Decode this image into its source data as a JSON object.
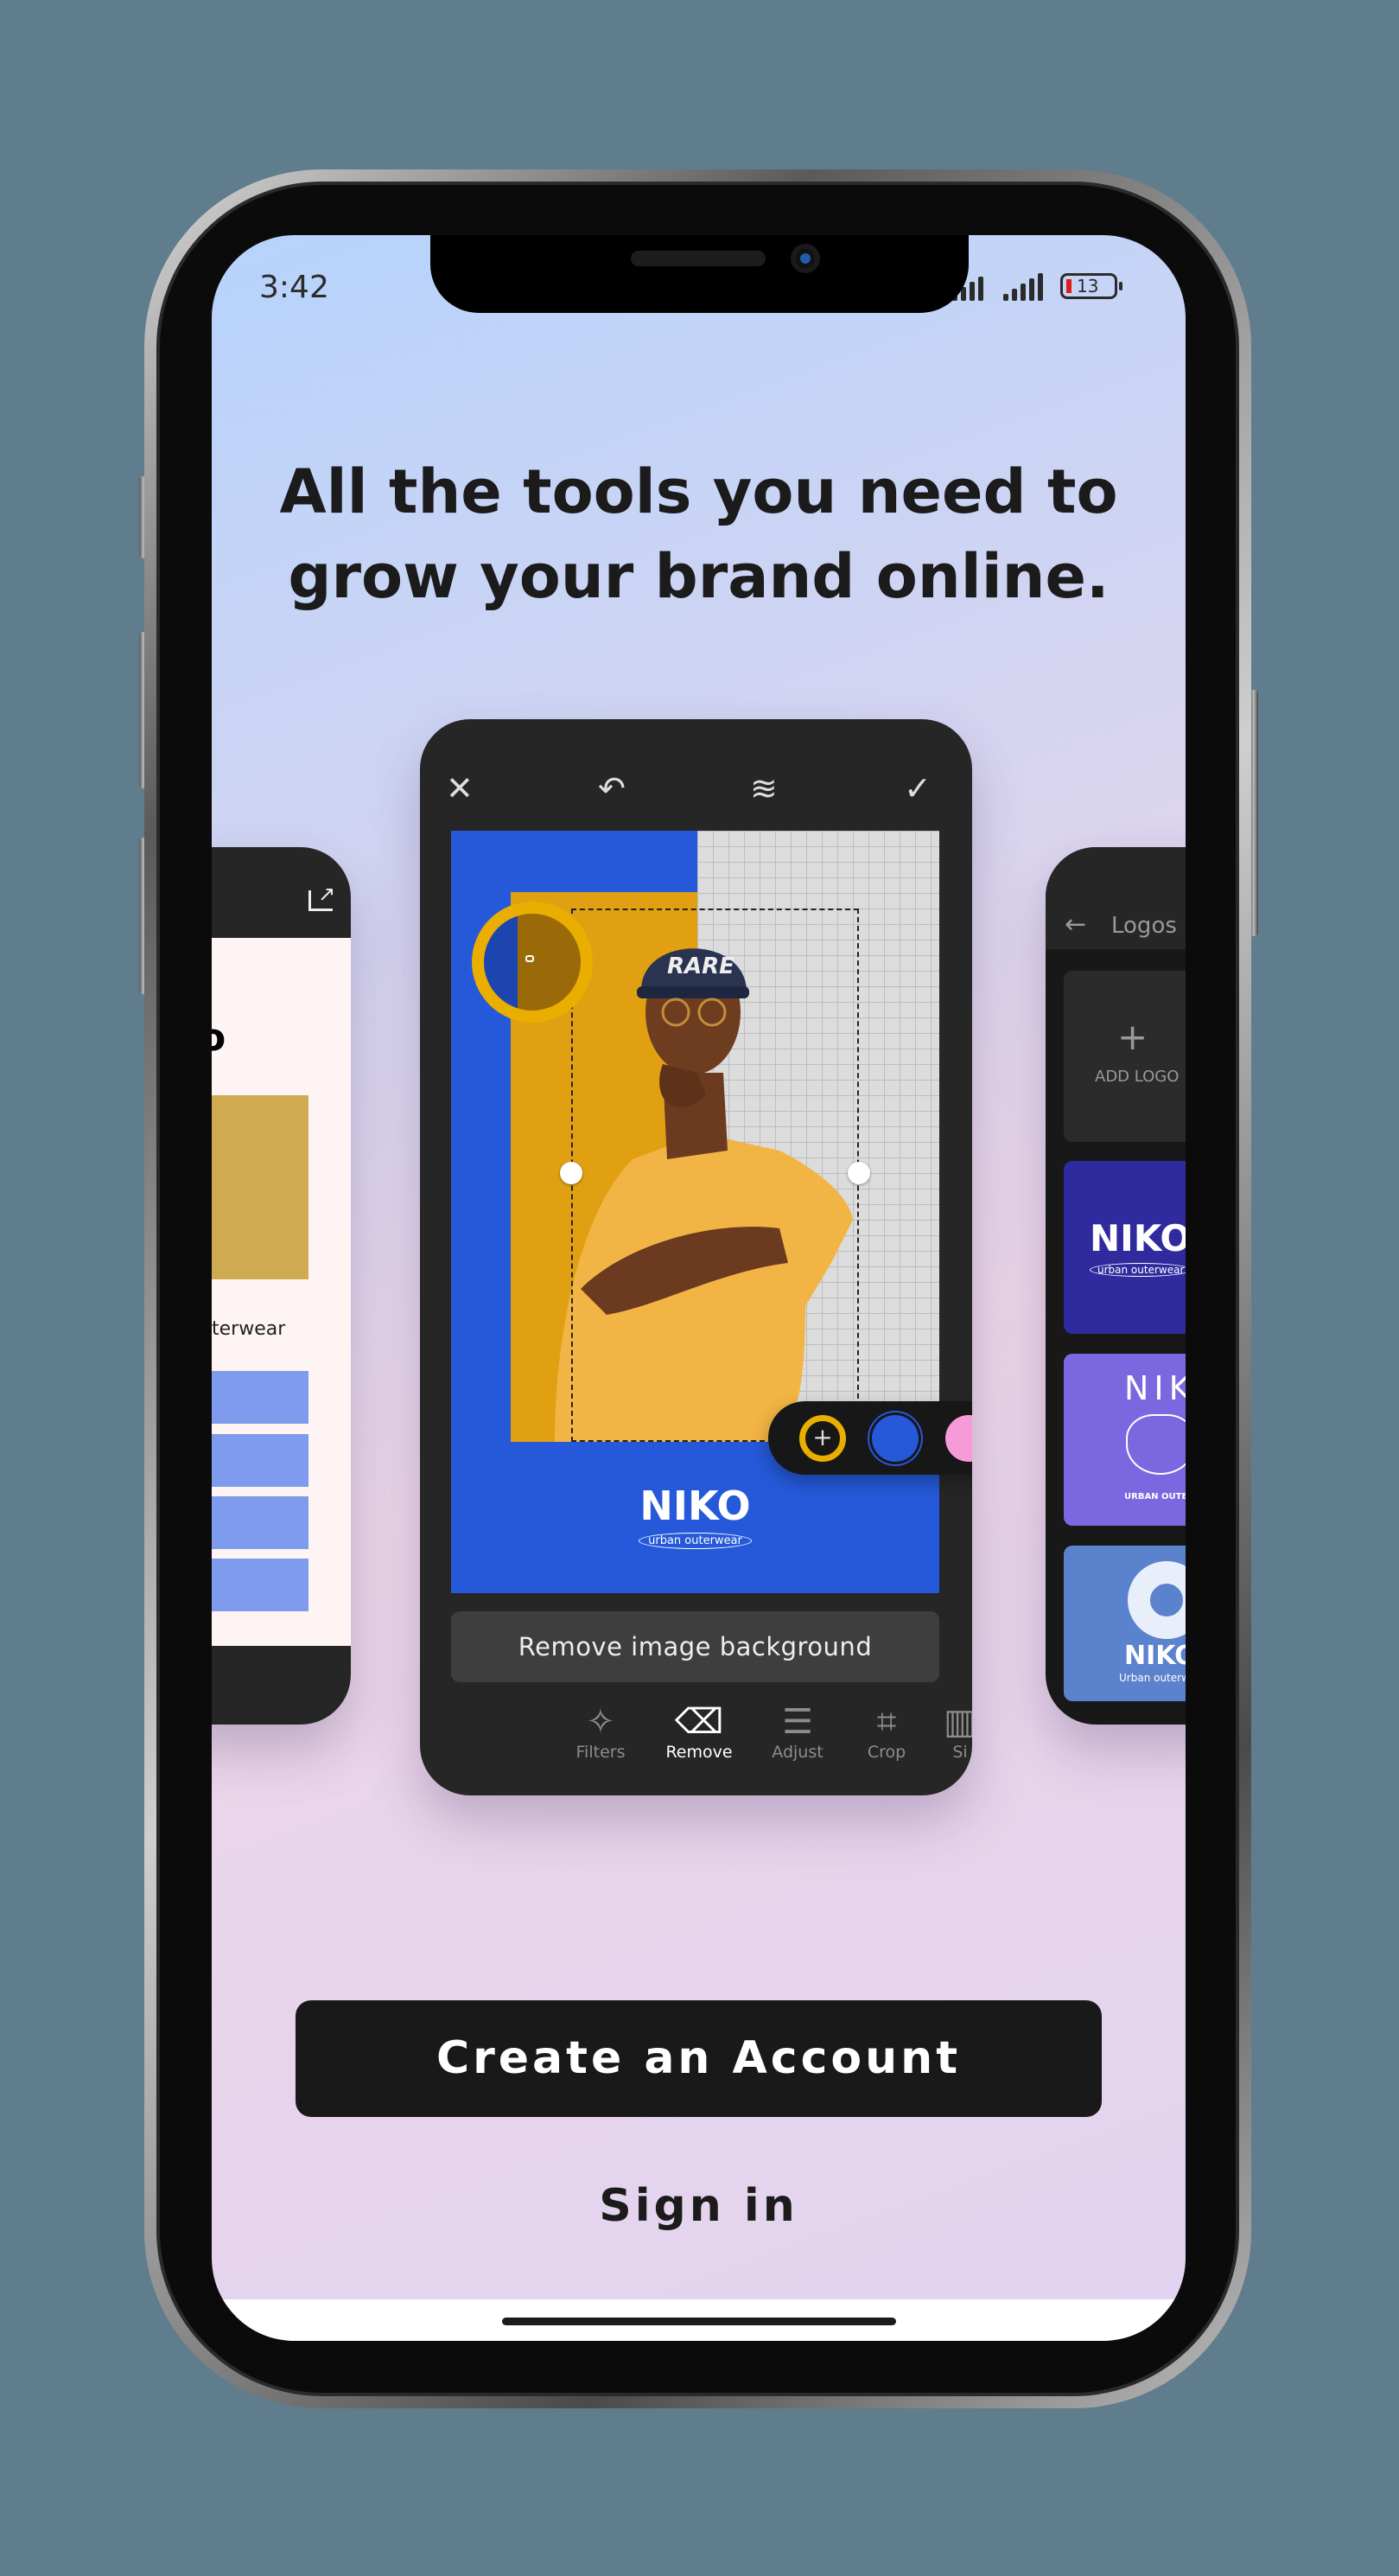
{
  "status_bar": {
    "time": "3:42",
    "battery": "13",
    "battery_color": "#e01b1b"
  },
  "headline": {
    "line1": "All the tools you need to",
    "line2": "grow your brand online."
  },
  "editor": {
    "toolbar": {
      "close_icon": "close-icon",
      "undo_icon": "undo-icon",
      "layers_icon": "layers-icon",
      "done_icon": "check-icon"
    },
    "canvas": {
      "logo": "NIKO",
      "tagline": "urban outerwear",
      "bg_color": "#2559d9",
      "accent_color": "#e0a012",
      "cap_text": "RARE"
    },
    "color_swatches": [
      {
        "color": "#e9ae00",
        "label": "+"
      },
      {
        "color": "#2559d9"
      },
      {
        "color": "#f79ad9"
      }
    ],
    "remove_bg_label": "Remove image background",
    "tabs": [
      {
        "label": "Filters",
        "icon": "filters-icon"
      },
      {
        "label": "Remove",
        "icon": "eraser-icon",
        "active": true
      },
      {
        "label": "Adjust",
        "icon": "sliders-icon"
      },
      {
        "label": "Crop",
        "icon": "crop-icon"
      },
      {
        "label": "Si",
        "icon": "size-icon"
      }
    ]
  },
  "left_card": {
    "heading_fragment": "o",
    "caption_fragment": "terwear"
  },
  "right_card": {
    "title": "Logos",
    "add_label": "ADD LOGO",
    "logos": [
      {
        "name": "NIKO",
        "tagline": "urban outerwear",
        "color": "#2f2b9f"
      },
      {
        "name": "NIKO",
        "tagline": "URBAN OUTERWEAR",
        "color": "#7b68e0"
      },
      {
        "name": "NIKO",
        "tagline": "Urban outerwear",
        "color": "#5b82cc"
      }
    ]
  },
  "actions": {
    "create_account": "Create an Account",
    "sign_in": "Sign in"
  }
}
